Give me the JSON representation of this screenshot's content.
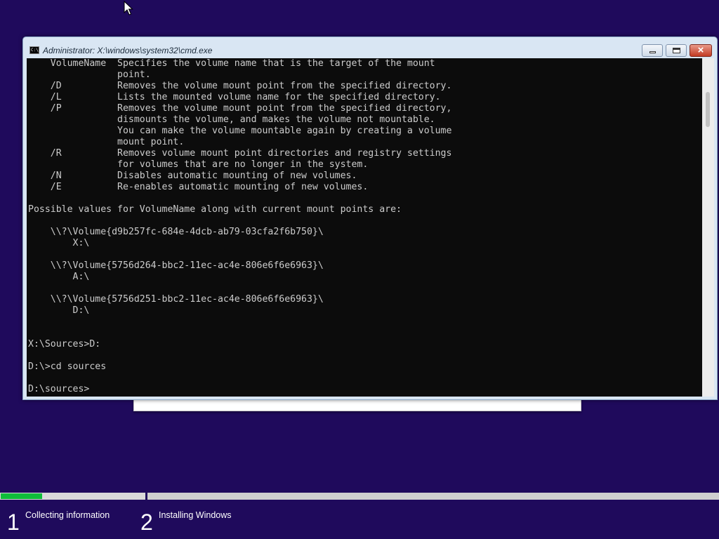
{
  "window": {
    "title": "Administrator: X:\\windows\\system32\\cmd.exe",
    "icon_text": "C:\\",
    "buttons": {
      "minimize": "minimize-icon",
      "maximize": "maximize-icon",
      "close": "×"
    }
  },
  "console": {
    "text": "    VolumeName  Specifies the volume name that is the target of the mount\n                point.\n    /D          Removes the volume mount point from the specified directory.\n    /L          Lists the mounted volume name for the specified directory.\n    /P          Removes the volume mount point from the specified directory,\n                dismounts the volume, and makes the volume not mountable.\n                You can make the volume mountable again by creating a volume\n                mount point.\n    /R          Removes volume mount point directories and registry settings\n                for volumes that are no longer in the system.\n    /N          Disables automatic mounting of new volumes.\n    /E          Re-enables automatic mounting of new volumes.\n\nPossible values for VolumeName along with current mount points are:\n\n    \\\\?\\Volume{d9b257fc-684e-4dcb-ab79-03cfa2f6b750}\\\n        X:\\\n\n    \\\\?\\Volume{5756d264-bbc2-11ec-ac4e-806e6f6e6963}\\\n        A:\\\n\n    \\\\?\\Volume{5756d251-bbc2-11ec-ac4e-806e6f6e6963}\\\n        D:\\\n\n\nX:\\Sources>D:\n\nD:\\>cd sources\n\nD:\\sources>"
  },
  "setup": {
    "progress": 0.29,
    "accent_color": "#0fbd3a",
    "background_color": "#1f0a5c",
    "steps": [
      {
        "number": "1",
        "label": "Collecting information"
      },
      {
        "number": "2",
        "label": "Installing Windows"
      }
    ]
  }
}
